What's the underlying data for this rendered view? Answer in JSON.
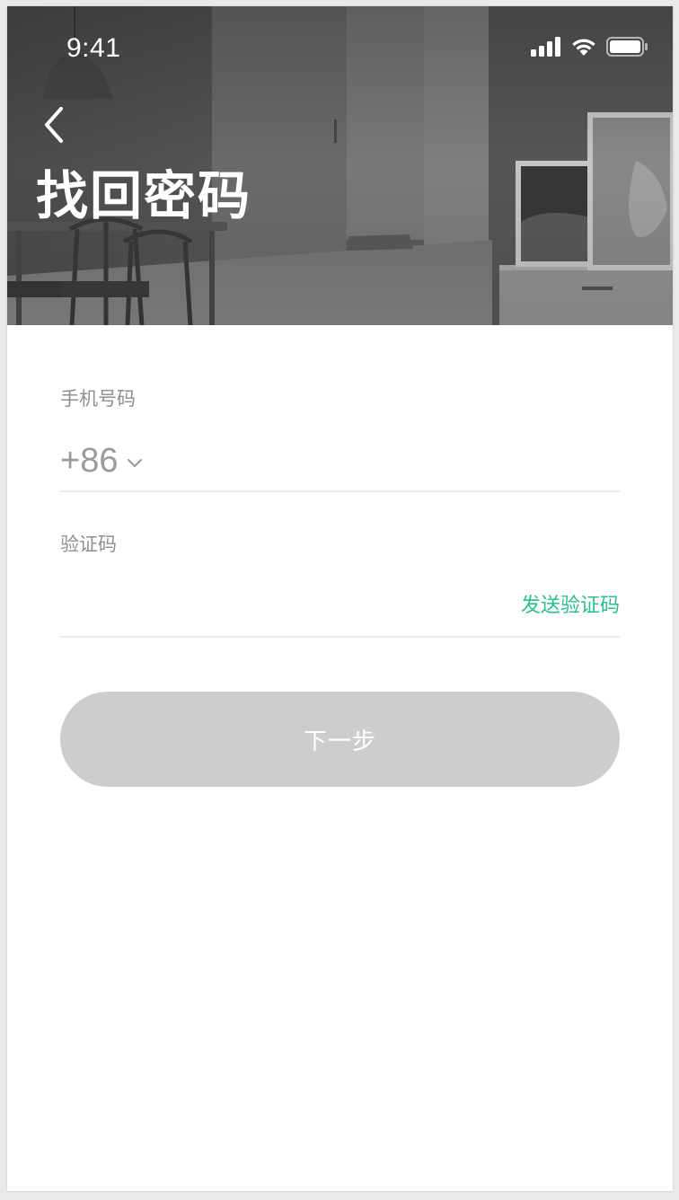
{
  "status_bar": {
    "time": "9:41",
    "icons": [
      "cellular-signal-icon",
      "wifi-icon",
      "battery-icon"
    ]
  },
  "header": {
    "back_icon": "chevron-left-icon",
    "title": "找回密码"
  },
  "form": {
    "phone": {
      "label": "手机号码",
      "country_code": "+86",
      "dropdown_icon": "chevron-down-icon",
      "value": ""
    },
    "code": {
      "label": "验证码",
      "value": "",
      "send_label": "发送验证码"
    },
    "next_button": "下一步"
  },
  "colors": {
    "accent": "#2bbd8a",
    "button_disabled": "#cdcdcd",
    "label": "#8f8f8f"
  }
}
